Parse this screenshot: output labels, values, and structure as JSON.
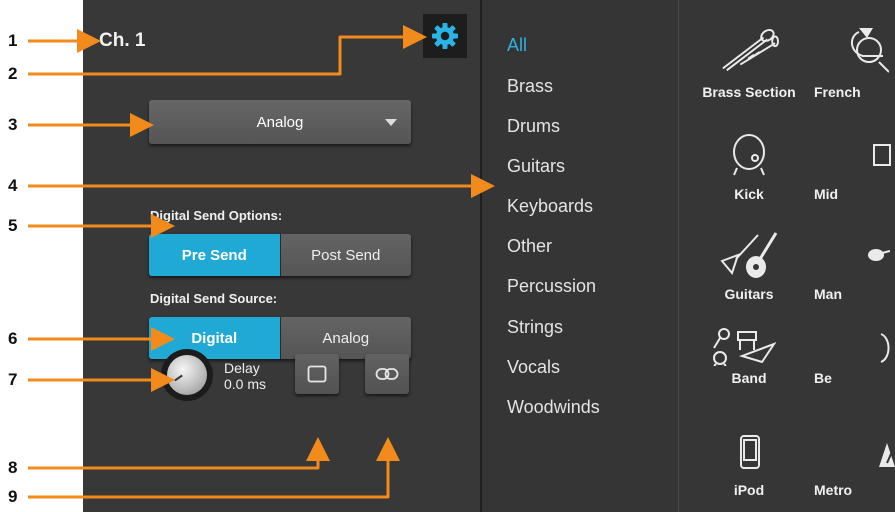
{
  "callouts": [
    "1",
    "2",
    "3",
    "4",
    "5",
    "6",
    "7",
    "8",
    "9"
  ],
  "channel": {
    "title": "Ch. 1"
  },
  "settings": {
    "icon": "gear-icon"
  },
  "input_dropdown": {
    "value": "Analog"
  },
  "digital_send_options": {
    "label": "Digital Send Options:",
    "options": [
      "Pre Send",
      "Post Send"
    ],
    "selected": "Pre Send"
  },
  "digital_send_source": {
    "label": "Digital Send Source:",
    "options": [
      "Digital",
      "Analog"
    ],
    "selected": "Digital"
  },
  "delay": {
    "label": "Delay",
    "value": "0.0 ms"
  },
  "categories": [
    "All",
    "Brass",
    "Drums",
    "Guitars",
    "Keyboards",
    "Other",
    "Percussion",
    "Strings",
    "Vocals",
    "Woodwinds"
  ],
  "selected_category": "All",
  "instruments": [
    {
      "left": "Brass Section",
      "right": "French"
    },
    {
      "left": "Kick",
      "right": "Mid"
    },
    {
      "left": "Guitars",
      "right": "Man"
    },
    {
      "left": "Band",
      "right": "Be"
    },
    {
      "left": "iPod",
      "right": "Metro"
    }
  ],
  "colors": {
    "accent": "#21a9d6",
    "callout_arrow": "#f28a1c",
    "panel": "#383838"
  }
}
